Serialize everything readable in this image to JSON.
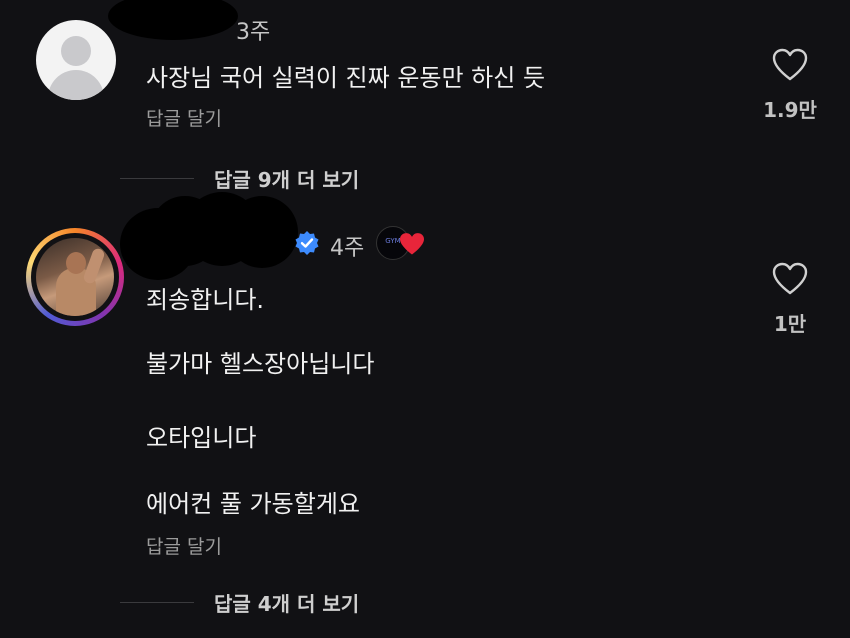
{
  "comments": [
    {
      "time": "3주",
      "text": "사장님 국어 실력이 진짜 운동만 하신 듯",
      "reply_label": "답글 달기",
      "like_count": "1.9만",
      "more_replies": "답글 9개 더 보기"
    },
    {
      "time": "4주",
      "lines": [
        "죄송합니다.",
        "불가마 헬스장아닙니다",
        "오타입니다",
        "에어컨 풀 가동할게요"
      ],
      "reply_label": "답글 달기",
      "like_count": "1만",
      "more_replies": "답글 4개 더 보기",
      "creator_badge_text": "GYM"
    }
  ],
  "colors": {
    "background": "#111114",
    "verified": "#3d8bfd",
    "heart_liked": "#e8253a"
  },
  "icons": [
    "heart-outline-icon",
    "verified-badge-icon",
    "creator-liked-heart-icon",
    "default-avatar-icon"
  ]
}
